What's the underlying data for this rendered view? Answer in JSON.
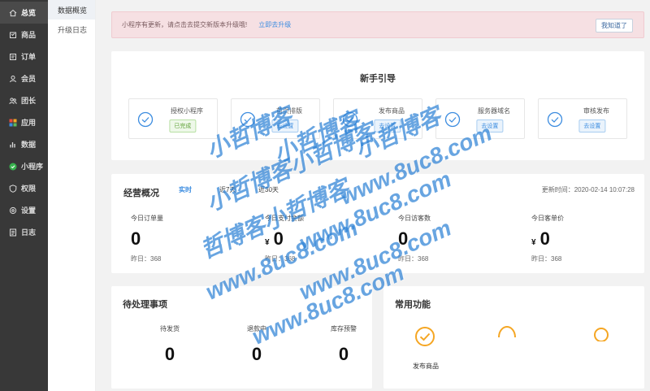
{
  "sidebar": {
    "items": [
      {
        "label": "总览",
        "icon": "home-icon"
      },
      {
        "label": "商品",
        "icon": "goods-icon"
      },
      {
        "label": "订单",
        "icon": "order-icon"
      },
      {
        "label": "会员",
        "icon": "member-icon"
      },
      {
        "label": "团长",
        "icon": "leader-icon"
      },
      {
        "label": "应用",
        "icon": "apps-icon"
      },
      {
        "label": "数据",
        "icon": "data-icon"
      },
      {
        "label": "小程序",
        "icon": "miniprogram-icon"
      },
      {
        "label": "权限",
        "icon": "permission-icon"
      },
      {
        "label": "设置",
        "icon": "settings-icon"
      },
      {
        "label": "日志",
        "icon": "log-icon"
      }
    ]
  },
  "submenu": {
    "items": [
      {
        "label": "数据概览"
      },
      {
        "label": "升级日志"
      }
    ]
  },
  "notice": {
    "text": "小程序有更新，请点击去提交新版本升级哦!",
    "link": "立即去升级",
    "button": "我知道了"
  },
  "guide": {
    "title": "新手引导",
    "steps": [
      {
        "name": "授权小程序",
        "status": "已完成",
        "state": "done"
      },
      {
        "name": "首页排版",
        "status": "去设置",
        "state": "todo"
      },
      {
        "name": "发布商品",
        "status": "去设置",
        "state": "todo"
      },
      {
        "name": "服务器域名",
        "status": "去设置",
        "state": "todo"
      },
      {
        "name": "审核发布",
        "status": "去设置",
        "state": "todo"
      }
    ]
  },
  "overview": {
    "title": "经营概况",
    "tabs": [
      "实时",
      "近7天",
      "近30天"
    ],
    "updated": "更新时间：2020-02-14 10:07:28",
    "metrics": [
      {
        "label": "今日订单量",
        "currency": "",
        "value": "0",
        "yesterday": "昨日：368"
      },
      {
        "label": "今日支付金额",
        "currency": "¥",
        "value": "0",
        "yesterday": "昨日：368"
      },
      {
        "label": "今日访客数",
        "currency": "",
        "value": "0",
        "yesterday": "昨日：368"
      },
      {
        "label": "今日客单价",
        "currency": "¥",
        "value": "0",
        "yesterday": "昨日：368"
      }
    ]
  },
  "pending": {
    "title": "待处理事项",
    "items": [
      {
        "label": "待发货",
        "value": "0"
      },
      {
        "label": "退款中",
        "value": "0"
      },
      {
        "label": "库存预警",
        "value": "0"
      }
    ]
  },
  "common": {
    "title": "常用功能",
    "items": [
      {
        "label": "发布商品",
        "icon": "check-circle-icon"
      }
    ]
  },
  "watermark": {
    "lines": [
      "小哲博客",
      "小哲博客",
      "小哲博客",
      "小哲博客小哲博客",
      "www.8uc8.com",
      "哲博客小哲博客",
      "www.8uc8.com",
      "www.8uc8.com",
      "www.8uc8.com",
      "www.8uc8.com"
    ]
  },
  "colors": {
    "sidebar_bg": "#383838",
    "accent": "#3d8de0",
    "success": "#62a33c",
    "notice_bg": "#f6e0e3",
    "icon_orange": "#f5a623"
  }
}
